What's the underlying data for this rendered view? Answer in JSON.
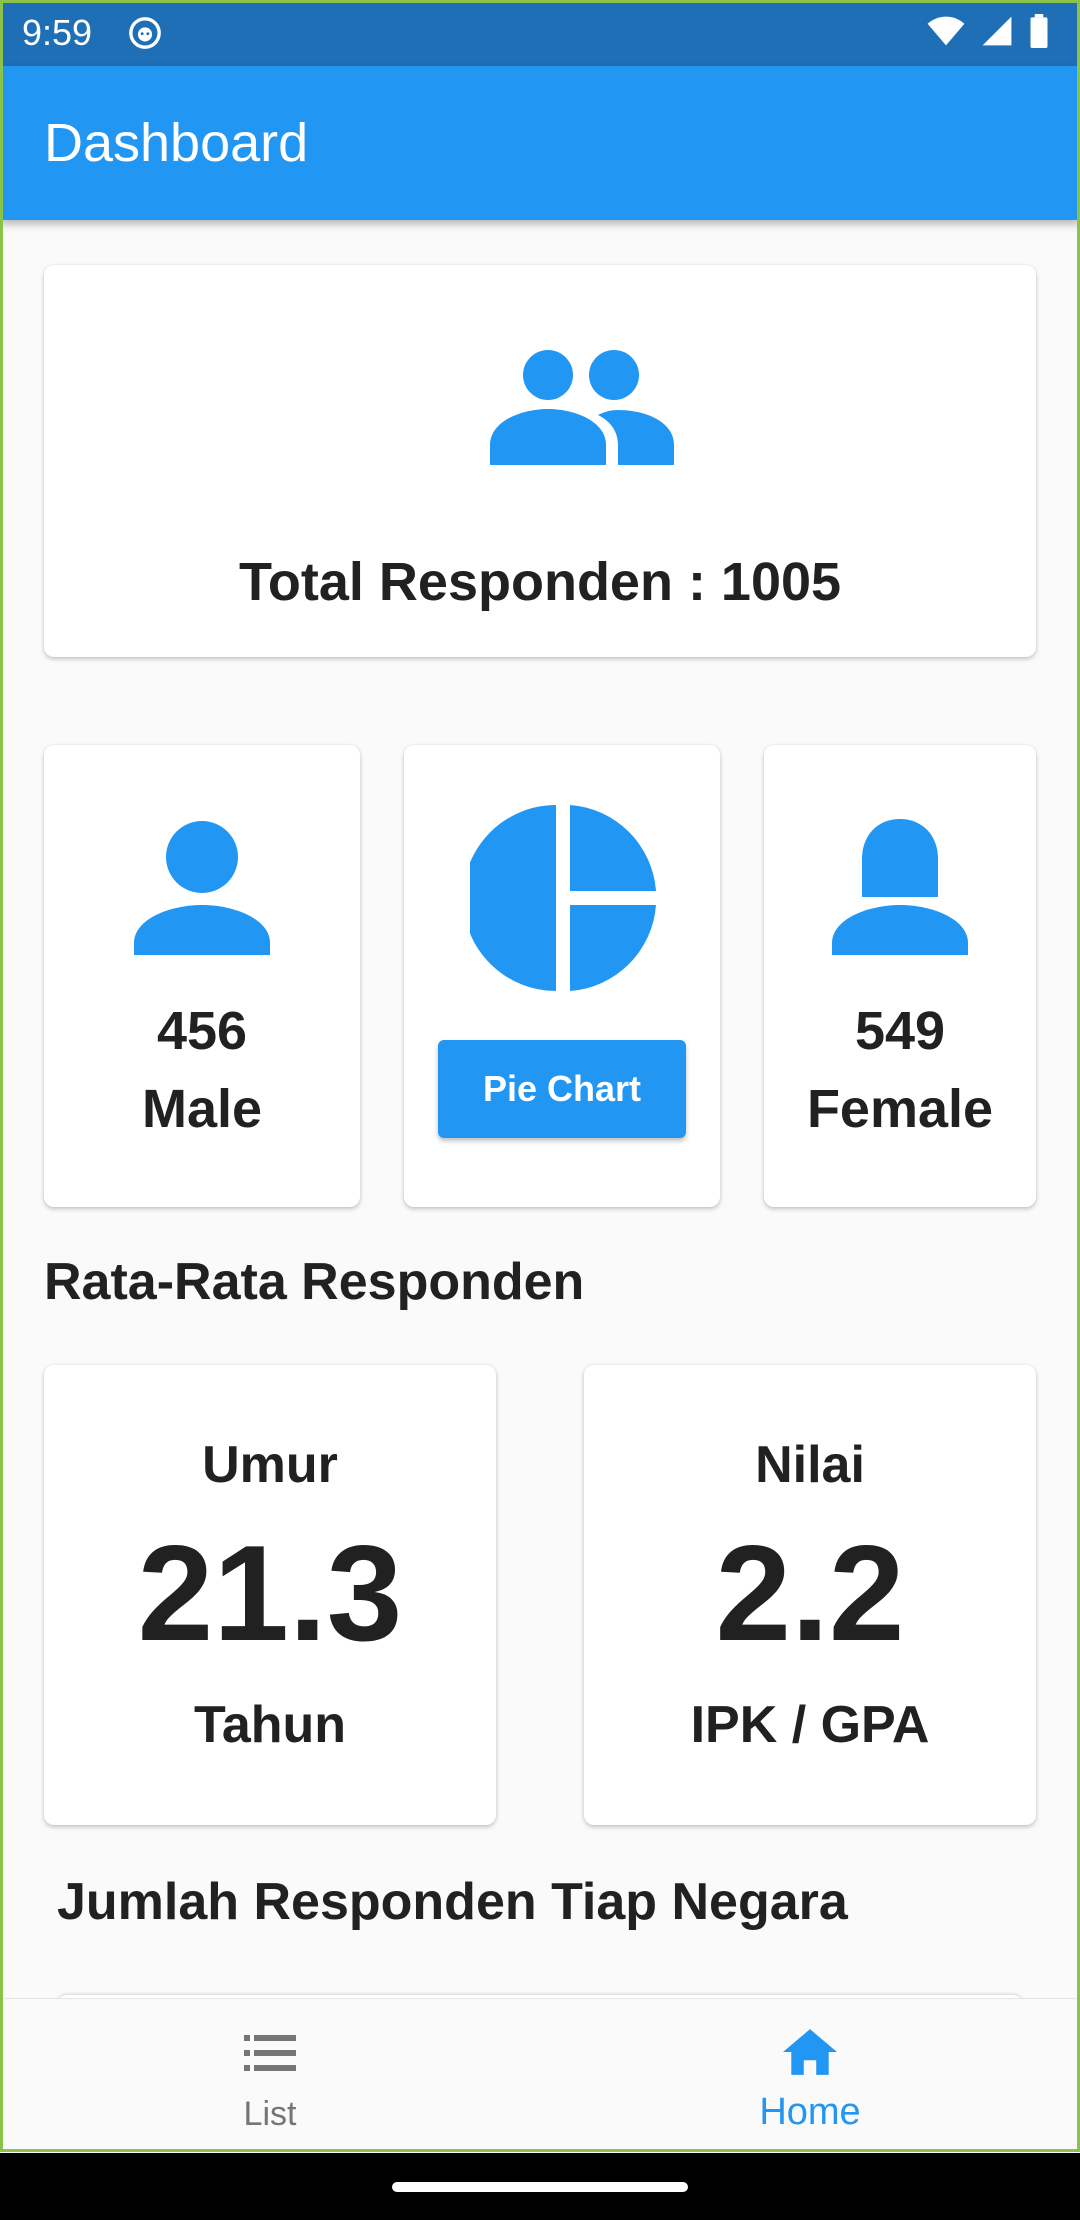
{
  "status_bar": {
    "time": "9:59"
  },
  "app_bar": {
    "title": "Dashboard"
  },
  "total": {
    "label": "Total Responden : 1005"
  },
  "gender": {
    "male": {
      "count": "456",
      "label": "Male"
    },
    "female": {
      "count": "549",
      "label": "Female"
    },
    "pie_button_label": "Pie Chart"
  },
  "averages": {
    "title": "Rata-Rata Responden",
    "age": {
      "label": "Umur",
      "value": "21.3",
      "unit": "Tahun"
    },
    "gpa": {
      "label": "Nilai",
      "value": "2.2",
      "unit": "IPK / GPA"
    }
  },
  "country_section": {
    "title": "Jumlah Responden Tiap Negara"
  },
  "bottom_nav": {
    "items": [
      {
        "label": "List",
        "icon": "list-icon",
        "active": false
      },
      {
        "label": "Home",
        "icon": "home-icon",
        "active": true
      }
    ]
  },
  "colors": {
    "primary": "#2196f3",
    "status_bar": "#1e6fb6",
    "text": "#212121",
    "inactive": "#757575"
  }
}
